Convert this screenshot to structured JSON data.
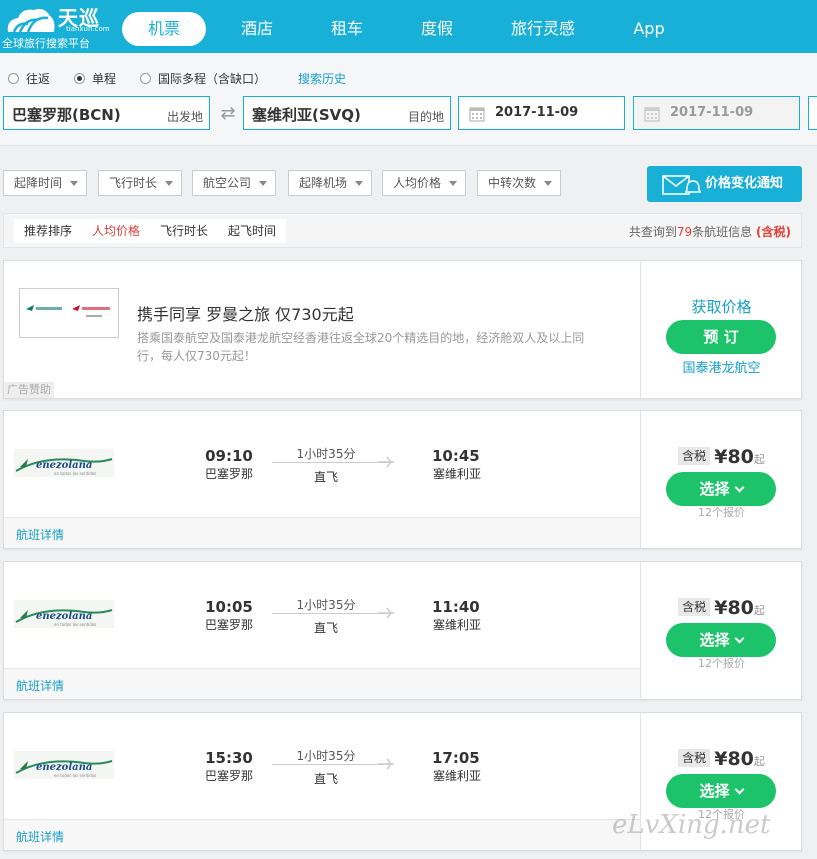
{
  "header": {
    "logo_name": "天巡",
    "logo_domain": "tianxun.com",
    "logo_slogan": "全球旅行搜索平台",
    "nav": [
      "机票",
      "酒店",
      "租车",
      "度假",
      "旅行灵感",
      "App"
    ],
    "active_nav": "机票",
    "brand_color": "#19b0d8"
  },
  "search": {
    "trip_types": [
      "往返",
      "单程",
      "国际多程（含缺口）"
    ],
    "selected_trip": "单程",
    "history_label": "搜索历史",
    "origin": "巴塞罗那(BCN)",
    "origin_tag": "出发地",
    "destination": "塞维利亚(SVQ)",
    "destination_tag": "目的地",
    "depart_date": "2017-11-09",
    "return_date": "2017-11-09"
  },
  "filters": [
    "起降时间",
    "飞行时长",
    "航空公司",
    "起降机场",
    "人均价格",
    "中转次数"
  ],
  "notify_label": "价格变化通知",
  "sort": {
    "tabs": [
      "推荐排序",
      "人均价格",
      "飞行时长",
      "起飞时间"
    ],
    "active": "人均价格",
    "count_prefix": "共查询到",
    "count": "79",
    "count_suffix": "条航班信息",
    "tax_label": "(含税)"
  },
  "ad": {
    "title": "携手同享 罗曼之旅 仅730元起",
    "desc": "搭乘国泰航空及国泰港龙航空经香港往返全球20个精选目的地，经济舱双人及以上同行，每人仅730元起！",
    "badge": "广告赞助",
    "get_price": "获取价格",
    "book": "预 订",
    "airline": "国泰港龙航空"
  },
  "flights": [
    {
      "dep_time": "09:10",
      "dep_city": "巴塞罗那",
      "duration": "1小时35分",
      "stops": "直飞",
      "arr_time": "10:45",
      "arr_city": "塞维利亚",
      "tax_tag": "含税",
      "price": "¥80",
      "suffix": "起",
      "select": "选择",
      "quotes": "12个报价",
      "detail": "航班详情"
    },
    {
      "dep_time": "10:05",
      "dep_city": "巴塞罗那",
      "duration": "1小时35分",
      "stops": "直飞",
      "arr_time": "11:40",
      "arr_city": "塞维利亚",
      "tax_tag": "含税",
      "price": "¥80",
      "suffix": "起",
      "select": "选择",
      "quotes": "12个报价",
      "detail": "航班详情"
    },
    {
      "dep_time": "15:30",
      "dep_city": "巴塞罗那",
      "duration": "1小时35分",
      "stops": "直飞",
      "arr_time": "17:05",
      "arr_city": "塞维利亚",
      "tax_tag": "含税",
      "price": "¥80",
      "suffix": "起",
      "select": "选择",
      "quotes": "12个报价",
      "detail": "航班详情"
    }
  ],
  "watermark": "eLvXing.net"
}
